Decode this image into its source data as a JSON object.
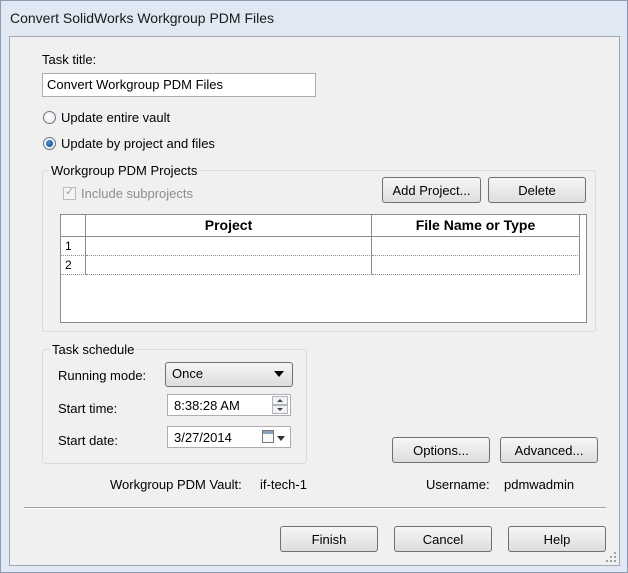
{
  "window": {
    "title": "Convert SolidWorks Workgroup PDM Files"
  },
  "task_title": {
    "label": "Task title:",
    "value": "Convert Workgroup PDM Files"
  },
  "update_options": [
    {
      "label": "Update entire vault",
      "selected": false
    },
    {
      "label": "Update by project and files",
      "selected": true
    }
  ],
  "projects": {
    "group_label": "Workgroup PDM Projects",
    "include_subprojects_label": "Include subprojects",
    "include_subprojects_checked": true,
    "add_button": "Add Project...",
    "delete_button": "Delete",
    "columns": [
      "Project",
      "File Name or Type"
    ],
    "rows": [
      {
        "num": "1",
        "project": "",
        "file": ""
      },
      {
        "num": "2",
        "project": "",
        "file": ""
      }
    ]
  },
  "schedule": {
    "group_label": "Task schedule",
    "running_mode_label": "Running mode:",
    "running_mode_value": "Once",
    "start_time_label": "Start time:",
    "start_time_value": "8:38:28 AM",
    "start_date_label": "Start date:",
    "start_date_value": "3/27/2014"
  },
  "buttons": {
    "options": "Options...",
    "advanced": "Advanced...",
    "finish": "Finish",
    "cancel": "Cancel",
    "help": "Help"
  },
  "footer_info": {
    "vault_label": "Workgroup PDM Vault:",
    "vault_value": "if-tech-1",
    "username_label": "Username:",
    "username_value": "pdmwadmin"
  }
}
